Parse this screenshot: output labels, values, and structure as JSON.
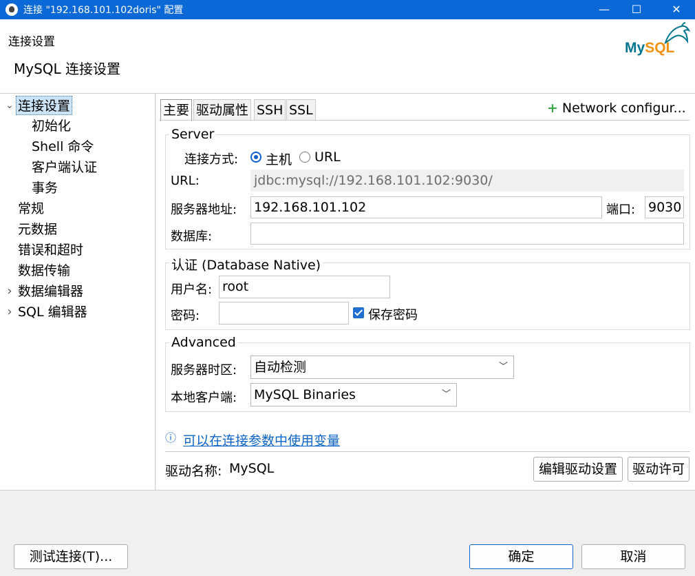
{
  "window": {
    "title": "连接 \"192.168.101.102doris\" 配置",
    "minimize_glyph": "—",
    "maximize_glyph": "☐",
    "close_glyph": "✕"
  },
  "header": {
    "section_title": "连接设置",
    "page_title": "MySQL 连接设置",
    "logo_my": "My",
    "logo_sql": "SQL"
  },
  "nav": {
    "items": [
      {
        "label": "连接设置",
        "arrow": "⌄",
        "selected": true
      },
      {
        "label": "初始化"
      },
      {
        "label": "Shell 命令"
      },
      {
        "label": "客户端认证"
      },
      {
        "label": "事务"
      },
      {
        "label": "常规"
      },
      {
        "label": "元数据"
      },
      {
        "label": "错误和超时"
      },
      {
        "label": "数据传输"
      },
      {
        "label": "数据编辑器",
        "arrow": "›"
      },
      {
        "label": "SQL 编辑器",
        "arrow": "›"
      }
    ]
  },
  "tabs": [
    {
      "label": "主要",
      "active": true
    },
    {
      "label": "驱动属性"
    },
    {
      "label": "SSH"
    },
    {
      "label": "SSL"
    }
  ],
  "network_config": {
    "plus": "+",
    "label": "Network configur..."
  },
  "server": {
    "title": "Server",
    "connect_by_label": "连接方式:",
    "option_host": "主机",
    "option_url": "URL",
    "url_label": "URL:",
    "url_value": "jdbc:mysql://192.168.101.102:9030/",
    "host_label": "服务器地址:",
    "host_value": "192.168.101.102",
    "port_label": "端口:",
    "port_value": "9030",
    "database_label": "数据库:",
    "database_value": ""
  },
  "auth": {
    "title": "认证 (Database Native)",
    "username_label": "用户名:",
    "username_value": "root",
    "password_label": "密码:",
    "password_value": "",
    "save_password_label": "保存密码",
    "save_password_checked": true
  },
  "advanced": {
    "title": "Advanced",
    "timezone_label": "服务器时区:",
    "timezone_value": "自动检测",
    "client_label": "本地客户端:",
    "client_value": "MySQL Binaries"
  },
  "variables_link": {
    "icon": "ⓘ",
    "label": "可以在连接参数中使用变量"
  },
  "driver": {
    "name_label": "驱动名称:",
    "name_value": "MySQL",
    "edit_button": "编辑驱动设置",
    "license_button": "驱动许可"
  },
  "footer": {
    "test_button": "测试连接(T)...",
    "ok_button": "确定",
    "cancel_button": "取消"
  },
  "colors": {
    "titlebar": "#0a69d6",
    "accent": "#0a64c8",
    "link": "#0a64c8",
    "mysql_blue": "#00758f",
    "mysql_orange": "#f29111"
  }
}
